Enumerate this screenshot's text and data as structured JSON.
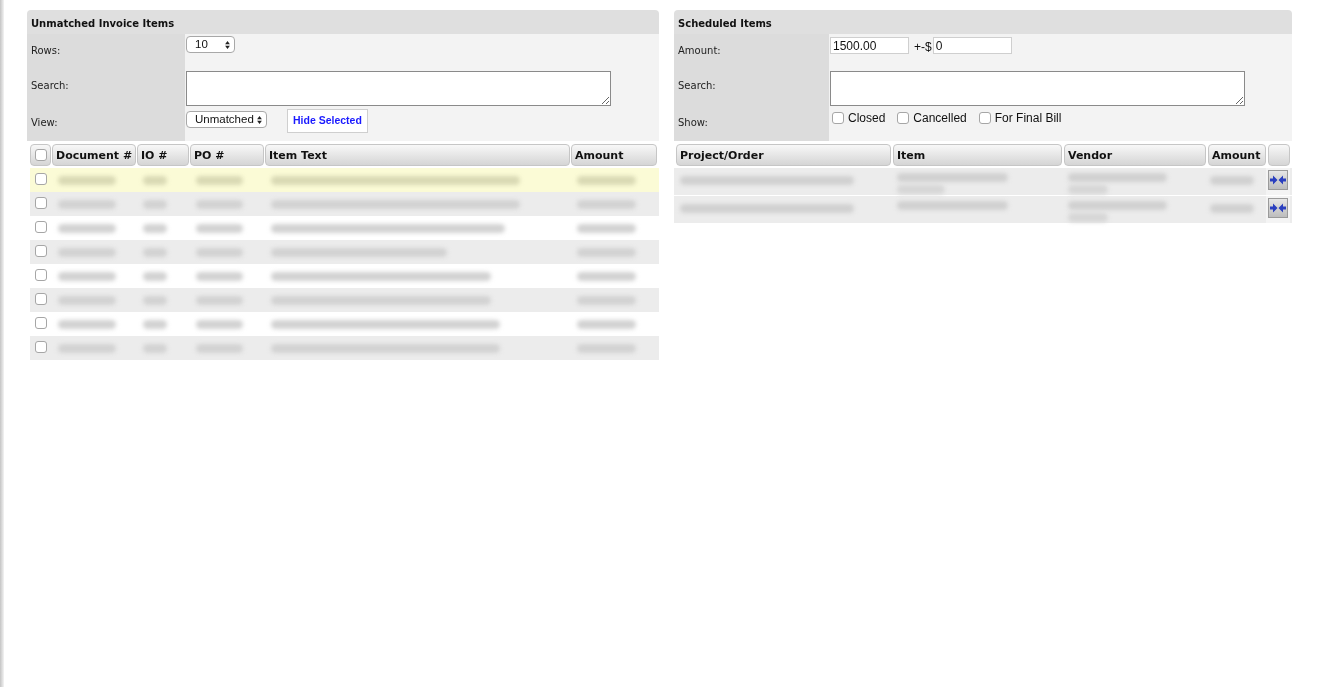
{
  "left_panel": {
    "title": "Unmatched Invoice Items",
    "filters": {
      "rows": {
        "label": "Rows:",
        "value": "10"
      },
      "search": {
        "label": "Search:"
      },
      "view": {
        "label": "View:",
        "value": "Unmatched"
      },
      "hide_selected_button": "Hide Selected"
    },
    "table": {
      "select_all": {
        "checked": false
      },
      "columns": [
        "Document #",
        "IO #",
        "PO #",
        "Item Text",
        "Amount"
      ],
      "rows": [
        {
          "highlighted": true,
          "checked": false,
          "blurred": true
        },
        {
          "highlighted": false,
          "checked": false,
          "blurred": true
        },
        {
          "highlighted": false,
          "checked": false,
          "blurred": true
        },
        {
          "highlighted": false,
          "checked": false,
          "blurred": true
        },
        {
          "highlighted": false,
          "checked": false,
          "blurred": true
        },
        {
          "highlighted": false,
          "checked": false,
          "blurred": true
        },
        {
          "highlighted": false,
          "checked": false,
          "blurred": true
        },
        {
          "highlighted": false,
          "checked": false,
          "blurred": true
        }
      ]
    }
  },
  "right_panel": {
    "title": "Scheduled Items",
    "filters": {
      "amount": {
        "label": "Amount:",
        "value": "1500.00",
        "tolerance_label": "+-$",
        "tolerance_value": "0"
      },
      "search": {
        "label": "Search:"
      },
      "show": {
        "label": "Show:",
        "options": [
          {
            "label": "Closed",
            "checked": false
          },
          {
            "label": "Cancelled",
            "checked": false
          },
          {
            "label": "For Final Bill",
            "checked": false
          }
        ]
      }
    },
    "table": {
      "columns": [
        "Project/Order",
        "Item",
        "Vendor",
        "Amount"
      ],
      "rows": [
        {
          "blurred": true
        },
        {
          "blurred": true
        }
      ]
    }
  }
}
